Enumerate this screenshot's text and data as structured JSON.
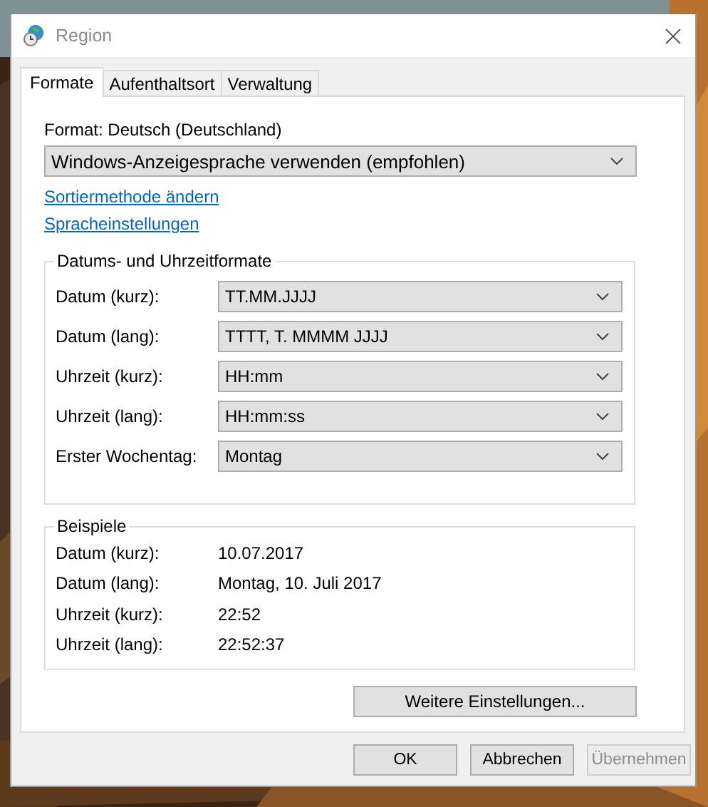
{
  "window": {
    "title": "Region"
  },
  "tabs": [
    {
      "label": "Formate",
      "selected": true
    },
    {
      "label": "Aufenthaltsort",
      "selected": false
    },
    {
      "label": "Verwaltung",
      "selected": false
    }
  ],
  "format_label": "Format: Deutsch (Deutschland)",
  "format_dropdown": {
    "value": "Windows-Anzeigesprache verwenden (empfohlen)"
  },
  "links": [
    "Sortiermethode ändern",
    "Spracheinstellungen"
  ],
  "formats_group": {
    "title": "Datums- und Uhrzeitformate",
    "rows": [
      {
        "label": "Datum (kurz):",
        "value": "TT.MM.JJJJ"
      },
      {
        "label": "Datum (lang):",
        "value": "TTTT, T. MMMM JJJJ"
      },
      {
        "label": "Uhrzeit (kurz):",
        "value": "HH:mm"
      },
      {
        "label": "Uhrzeit (lang):",
        "value": "HH:mm:ss"
      },
      {
        "label": "Erster Wochentag:",
        "value": "Montag"
      }
    ]
  },
  "examples_group": {
    "title": "Beispiele",
    "rows": [
      {
        "label": "Datum (kurz):",
        "value": "10.07.2017"
      },
      {
        "label": "Datum (lang):",
        "value": "Montag, 10. Juli 2017"
      },
      {
        "label": "Uhrzeit (kurz):",
        "value": "22:52"
      },
      {
        "label": "Uhrzeit (lang):",
        "value": "22:52:37"
      }
    ]
  },
  "more_button": "Weitere Einstellungen...",
  "buttons": [
    {
      "label": "OK",
      "disabled": false
    },
    {
      "label": "Abbrechen",
      "disabled": false
    },
    {
      "label": "Übernehmen",
      "disabled": true
    }
  ]
}
